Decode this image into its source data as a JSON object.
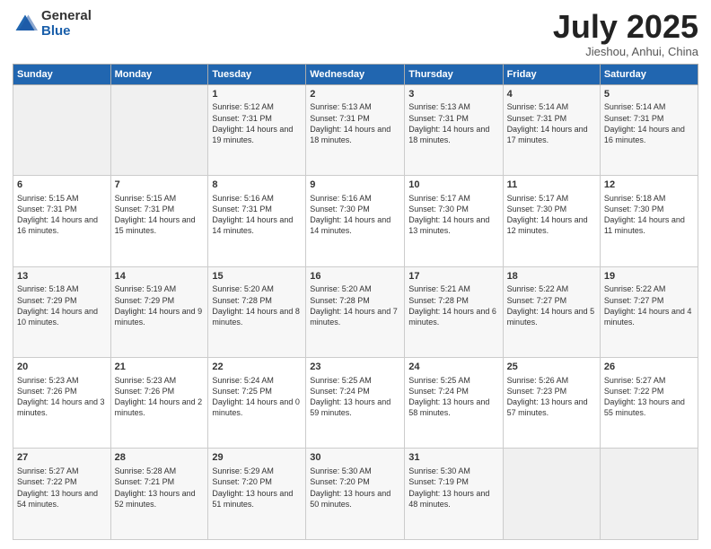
{
  "logo": {
    "general": "General",
    "blue": "Blue"
  },
  "title": "July 2025",
  "subtitle": "Jieshou, Anhui, China",
  "days_of_week": [
    "Sunday",
    "Monday",
    "Tuesday",
    "Wednesday",
    "Thursday",
    "Friday",
    "Saturday"
  ],
  "weeks": [
    [
      {
        "day": "",
        "info": ""
      },
      {
        "day": "",
        "info": ""
      },
      {
        "day": "1",
        "info": "Sunrise: 5:12 AM\nSunset: 7:31 PM\nDaylight: 14 hours and 19 minutes."
      },
      {
        "day": "2",
        "info": "Sunrise: 5:13 AM\nSunset: 7:31 PM\nDaylight: 14 hours and 18 minutes."
      },
      {
        "day": "3",
        "info": "Sunrise: 5:13 AM\nSunset: 7:31 PM\nDaylight: 14 hours and 18 minutes."
      },
      {
        "day": "4",
        "info": "Sunrise: 5:14 AM\nSunset: 7:31 PM\nDaylight: 14 hours and 17 minutes."
      },
      {
        "day": "5",
        "info": "Sunrise: 5:14 AM\nSunset: 7:31 PM\nDaylight: 14 hours and 16 minutes."
      }
    ],
    [
      {
        "day": "6",
        "info": "Sunrise: 5:15 AM\nSunset: 7:31 PM\nDaylight: 14 hours and 16 minutes."
      },
      {
        "day": "7",
        "info": "Sunrise: 5:15 AM\nSunset: 7:31 PM\nDaylight: 14 hours and 15 minutes."
      },
      {
        "day": "8",
        "info": "Sunrise: 5:16 AM\nSunset: 7:31 PM\nDaylight: 14 hours and 14 minutes."
      },
      {
        "day": "9",
        "info": "Sunrise: 5:16 AM\nSunset: 7:30 PM\nDaylight: 14 hours and 14 minutes."
      },
      {
        "day": "10",
        "info": "Sunrise: 5:17 AM\nSunset: 7:30 PM\nDaylight: 14 hours and 13 minutes."
      },
      {
        "day": "11",
        "info": "Sunrise: 5:17 AM\nSunset: 7:30 PM\nDaylight: 14 hours and 12 minutes."
      },
      {
        "day": "12",
        "info": "Sunrise: 5:18 AM\nSunset: 7:30 PM\nDaylight: 14 hours and 11 minutes."
      }
    ],
    [
      {
        "day": "13",
        "info": "Sunrise: 5:18 AM\nSunset: 7:29 PM\nDaylight: 14 hours and 10 minutes."
      },
      {
        "day": "14",
        "info": "Sunrise: 5:19 AM\nSunset: 7:29 PM\nDaylight: 14 hours and 9 minutes."
      },
      {
        "day": "15",
        "info": "Sunrise: 5:20 AM\nSunset: 7:28 PM\nDaylight: 14 hours and 8 minutes."
      },
      {
        "day": "16",
        "info": "Sunrise: 5:20 AM\nSunset: 7:28 PM\nDaylight: 14 hours and 7 minutes."
      },
      {
        "day": "17",
        "info": "Sunrise: 5:21 AM\nSunset: 7:28 PM\nDaylight: 14 hours and 6 minutes."
      },
      {
        "day": "18",
        "info": "Sunrise: 5:22 AM\nSunset: 7:27 PM\nDaylight: 14 hours and 5 minutes."
      },
      {
        "day": "19",
        "info": "Sunrise: 5:22 AM\nSunset: 7:27 PM\nDaylight: 14 hours and 4 minutes."
      }
    ],
    [
      {
        "day": "20",
        "info": "Sunrise: 5:23 AM\nSunset: 7:26 PM\nDaylight: 14 hours and 3 minutes."
      },
      {
        "day": "21",
        "info": "Sunrise: 5:23 AM\nSunset: 7:26 PM\nDaylight: 14 hours and 2 minutes."
      },
      {
        "day": "22",
        "info": "Sunrise: 5:24 AM\nSunset: 7:25 PM\nDaylight: 14 hours and 0 minutes."
      },
      {
        "day": "23",
        "info": "Sunrise: 5:25 AM\nSunset: 7:24 PM\nDaylight: 13 hours and 59 minutes."
      },
      {
        "day": "24",
        "info": "Sunrise: 5:25 AM\nSunset: 7:24 PM\nDaylight: 13 hours and 58 minutes."
      },
      {
        "day": "25",
        "info": "Sunrise: 5:26 AM\nSunset: 7:23 PM\nDaylight: 13 hours and 57 minutes."
      },
      {
        "day": "26",
        "info": "Sunrise: 5:27 AM\nSunset: 7:22 PM\nDaylight: 13 hours and 55 minutes."
      }
    ],
    [
      {
        "day": "27",
        "info": "Sunrise: 5:27 AM\nSunset: 7:22 PM\nDaylight: 13 hours and 54 minutes."
      },
      {
        "day": "28",
        "info": "Sunrise: 5:28 AM\nSunset: 7:21 PM\nDaylight: 13 hours and 52 minutes."
      },
      {
        "day": "29",
        "info": "Sunrise: 5:29 AM\nSunset: 7:20 PM\nDaylight: 13 hours and 51 minutes."
      },
      {
        "day": "30",
        "info": "Sunrise: 5:30 AM\nSunset: 7:20 PM\nDaylight: 13 hours and 50 minutes."
      },
      {
        "day": "31",
        "info": "Sunrise: 5:30 AM\nSunset: 7:19 PM\nDaylight: 13 hours and 48 minutes."
      },
      {
        "day": "",
        "info": ""
      },
      {
        "day": "",
        "info": ""
      }
    ]
  ]
}
